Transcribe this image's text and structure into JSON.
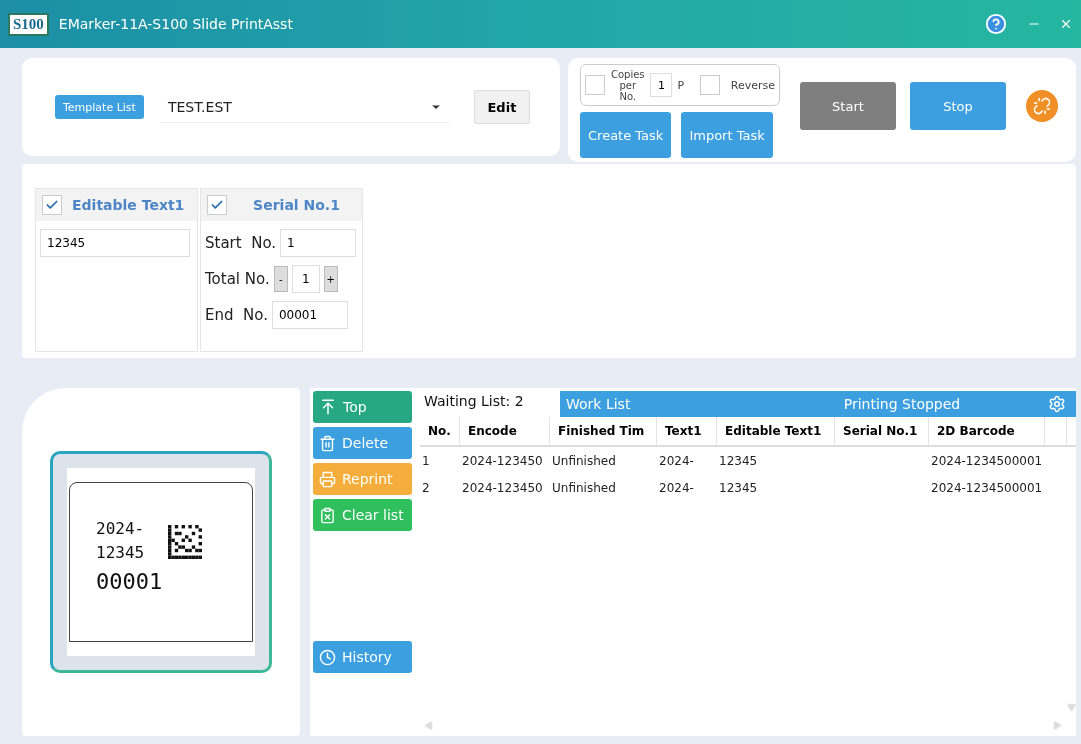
{
  "window": {
    "logo": "S100",
    "title": "EMarker-11A-S100 Slide PrintAsst"
  },
  "template": {
    "list_button": "Template List",
    "selected": "TEST.EST",
    "edit_button": "Edit"
  },
  "options": {
    "copies": {
      "checked": false,
      "label": "Copies per No.",
      "value": "1",
      "unit": "P"
    },
    "reverse": {
      "checked": false,
      "label": "Reverse"
    }
  },
  "task_buttons": [
    {
      "label": "Create Task"
    },
    {
      "label": "Import Task"
    }
  ],
  "run_buttons": [
    {
      "label": "Start",
      "disabled": true
    },
    {
      "label": "Stop",
      "disabled": false
    }
  ],
  "fields": {
    "editable": {
      "checked": true,
      "title": "Editable Text1",
      "value": "12345"
    },
    "serial": {
      "checked": true,
      "title": "Serial No.1",
      "start_label": "Start  No.",
      "start": "1",
      "total_label": "Total No.",
      "minus": "-",
      "total": "1",
      "plus": "+",
      "end_label": "End  No.",
      "end": "00001"
    }
  },
  "preview": {
    "lines": [
      "2024-",
      "12345"
    ],
    "serial": "00001"
  },
  "side_buttons": [
    {
      "kind": "top",
      "label": "Top",
      "color": "#26a883"
    },
    {
      "kind": "delete",
      "label": "Delete",
      "color": "#3c9fe0"
    },
    {
      "kind": "reprint",
      "label": "Reprint",
      "color": "#f5ae3b"
    },
    {
      "kind": "clear",
      "label": "Clear list",
      "color": "#2fbf5c"
    },
    {
      "kind": "history",
      "label": "History",
      "color": "#3c9fe0"
    }
  ],
  "list": {
    "waiting": "Waiting List: 2",
    "tab": "Work List",
    "status": "Printing Stopped",
    "columns": [
      "No.",
      "Encode",
      "Finished Tim",
      "Text1",
      "Editable Text1",
      "Serial No.1",
      "2D Barcode"
    ],
    "rows": [
      [
        "1",
        "2024-123450",
        "Unfinished",
        "2024-",
        "12345",
        "",
        "2024-1234500001"
      ],
      [
        "2",
        "2024-123450",
        "Unfinished",
        "2024-",
        "12345",
        "",
        "2024-1234500001"
      ]
    ]
  }
}
